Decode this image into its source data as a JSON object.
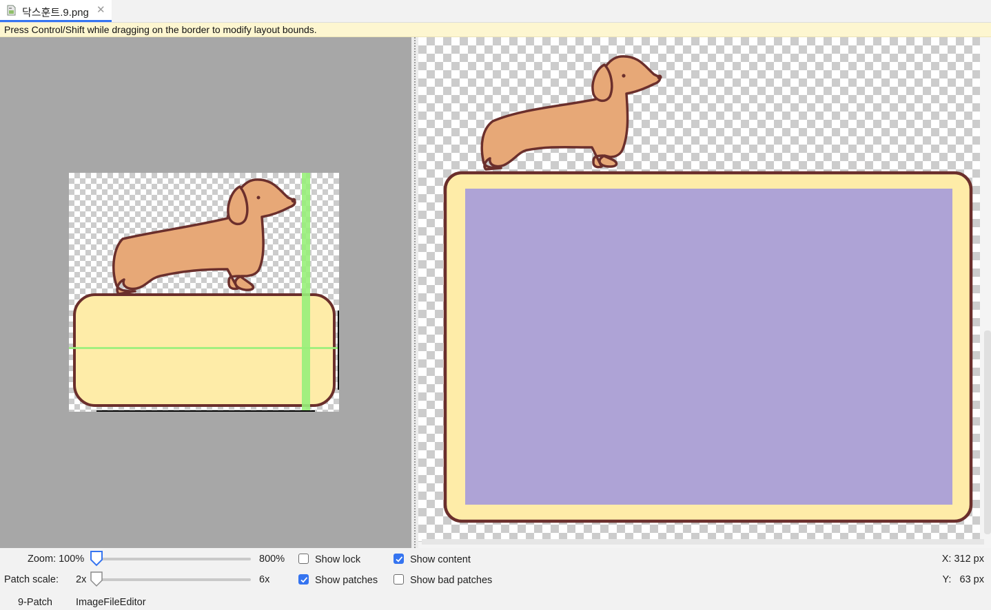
{
  "tab": {
    "title": "닥스훈트.9.png",
    "close_icon": "close-icon",
    "file_icon": "image-file-icon"
  },
  "hint": "Press Control/Shift while dragging on the border to modify layout bounds.",
  "colors": {
    "editor_bg": "#a7a7a7",
    "patch_green": "#98f07a",
    "box_fill": "#feeca8",
    "box_border": "#6b2f2c",
    "content_purple": "#aea3d6",
    "dog_fill": "#e7a877",
    "accent": "#3574f0"
  },
  "controls": {
    "zoom": {
      "label": "Zoom: 100%",
      "max_label": "800%",
      "position": 0.0
    },
    "patch_scale": {
      "label": "Patch scale:",
      "min_label": "2x",
      "max_label": "6x",
      "position": 0.0
    },
    "show_lock": {
      "label": "Show lock",
      "checked": false
    },
    "show_patches": {
      "label": "Show patches",
      "checked": true
    },
    "show_content": {
      "label": "Show content",
      "checked": true
    },
    "show_bad_patches": {
      "label": "Show bad patches",
      "checked": false
    }
  },
  "coords": {
    "x": "X: 312 px",
    "y": "Y:   63 px"
  },
  "editor_tabs": [
    "9-Patch",
    "ImageFileEditor"
  ]
}
